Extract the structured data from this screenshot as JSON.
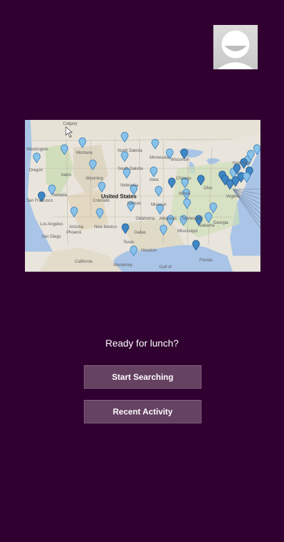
{
  "profile": {
    "avatar_icon": "user-avatar-icon"
  },
  "map": {
    "labels": {
      "calgary": "Calgary",
      "washington": "Washington",
      "montana": "Montana",
      "north_dakota": "North Dakota",
      "minnesota": "Minnesota",
      "oregon": "Oregon",
      "idaho": "Idaho",
      "wyoming": "Wyoming",
      "south_dakota": "South Dakota",
      "nebraska": "Nebraska",
      "iowa": "Iowa",
      "nevada": "Nevada",
      "united_states": "United States",
      "colorado": "Colorado",
      "kansas": "Kansas",
      "missouri": "Missouri",
      "san_francisco": "San Francisco",
      "los_angeles": "Los Angeles",
      "san_diego": "San Diego",
      "arizona": "Arizona",
      "phoenix": "Phoenix",
      "new_mexico": "New Mexico",
      "oklahoma": "Oklahoma",
      "dallas": "Dallas",
      "texas": "Texas",
      "houston": "Houston",
      "monterrey": "Monterrey",
      "gulf": "Gulf of",
      "california": "California",
      "wisconsin": "Wisconsin",
      "chicago": "Chicago",
      "illinois": "Illinois",
      "tennessee": "Tennessee",
      "alabama": "Alabama",
      "georgia": "Georgia",
      "florida": "Florida",
      "arkansas": "Arkansas",
      "mississippi": "Mississippi",
      "virginia": "Virginia",
      "new_york": "New York",
      "ohio": "Ohio"
    }
  },
  "main": {
    "prompt": "Ready for lunch?",
    "start_button": "Start Searching",
    "recent_button": "Recent Activity"
  }
}
